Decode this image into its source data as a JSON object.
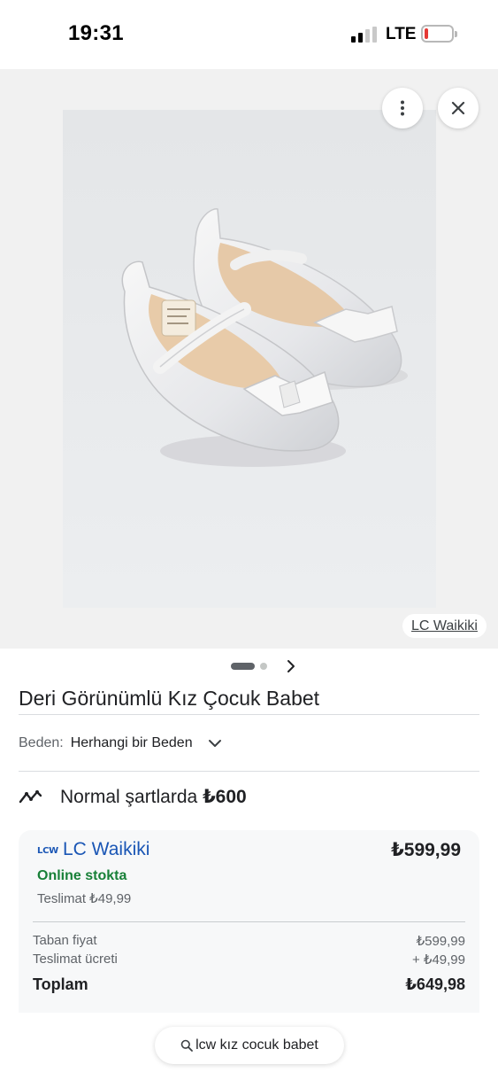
{
  "status_bar": {
    "time": "19:31",
    "network": "LTE",
    "battery_level": 0.15,
    "signal_bars": 2
  },
  "image_viewer": {
    "photo_icon": "white-ballet-flats-with-bow",
    "more_icon": "more-vert-icon",
    "close_icon": "close-icon",
    "source_label": "LC Waikiki",
    "pager": {
      "pages": 2,
      "current": 1
    }
  },
  "product": {
    "title": "Deri Görünümlü Kız Çocuk Babet",
    "size_label": "Beden:",
    "size_value": "Herhangi bir Beden"
  },
  "price_trend": {
    "text": "Normal şartlarda",
    "price": "₺600"
  },
  "offer": {
    "store_logo": "LCW",
    "store_name": "LC Waikiki",
    "price": "₺599,99",
    "stock": "Online stokta",
    "shipping": "Teslimat ₺49,99",
    "rows": [
      {
        "label": "Taban fiyat",
        "value": "₺599,99"
      },
      {
        "label": "Teslimat ücreti",
        "value": "+ ₺49,99"
      }
    ],
    "total": {
      "label": "Toplam",
      "value": "₺649,98"
    }
  },
  "search": {
    "query": "lcw kız cocuk babet"
  },
  "colors": {
    "link_blue": "#1a56b5",
    "stock_green": "#188038",
    "battery_red": "#e53935"
  }
}
